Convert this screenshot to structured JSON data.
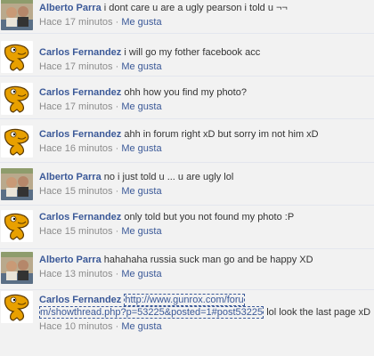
{
  "meta_separator": "·",
  "like_label": "Me gusta",
  "comments": [
    {
      "author": "Alberto Parra",
      "text": "i dont care u are a ugly pearson i told u ¬¬",
      "time": "Hace 17 minutos",
      "avatar": "photo"
    },
    {
      "author": "Carlos Fernandez",
      "text": "i will go my fother facebook acc",
      "time": "Hace 17 minutos",
      "avatar": "creature"
    },
    {
      "author": "Carlos Fernandez",
      "text": "ohh how you find my photo?",
      "time": "Hace 17 minutos",
      "avatar": "creature"
    },
    {
      "author": "Carlos Fernandez",
      "text": "ahh in forum right xD but sorry im not him xD",
      "time": "Hace 16 minutos",
      "avatar": "creature"
    },
    {
      "author": "Alberto Parra",
      "text": "no i just told u ... u are ugly lol",
      "time": "Hace 15 minutos",
      "avatar": "photo"
    },
    {
      "author": "Carlos Fernandez",
      "text": "only told but you not found my photo :P",
      "time": "Hace 15 minutos",
      "avatar": "creature"
    },
    {
      "author": "Alberto Parra",
      "text": "hahahaha russia suck man go and be happy XD",
      "time": "Hace 13 minutos",
      "avatar": "photo"
    },
    {
      "author": "Carlos Fernandez",
      "link_part1": "http://www.gunrox.com/foru",
      "link_part2": "m/showthread.php?p=53225&posted=1#post53225",
      "text": "lol look the last page xD",
      "time": "Hace 10 minutos",
      "avatar": "creature"
    }
  ],
  "colors": {
    "author": "#3b5998",
    "meta": "#8c8c8c",
    "background": "#f2f2f2",
    "creature": "#e8a000"
  }
}
